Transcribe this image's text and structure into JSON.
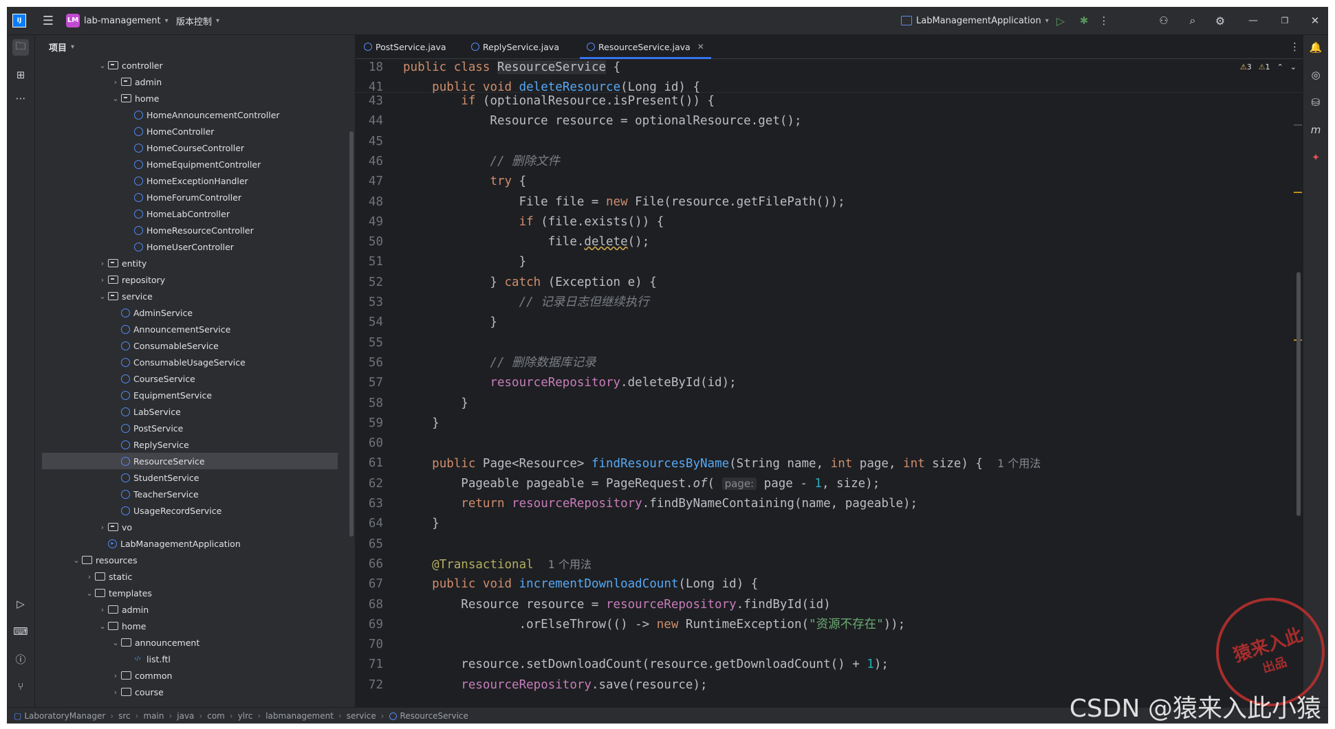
{
  "titlebar": {
    "project_badge": "LM",
    "project_name": "lab-management",
    "vcs_label": "版本控制",
    "run_config": "LabManagementApplication"
  },
  "project_panel": {
    "title": "项目",
    "tree": [
      {
        "label": "controller",
        "kind": "package",
        "arrow": "open",
        "indent": 0
      },
      {
        "label": "admin",
        "kind": "package",
        "arrow": "closed",
        "indent": 1
      },
      {
        "label": "home",
        "kind": "package",
        "arrow": "open",
        "indent": 1
      },
      {
        "label": "HomeAnnouncementController",
        "kind": "class",
        "indent": 2
      },
      {
        "label": "HomeController",
        "kind": "class",
        "indent": 2
      },
      {
        "label": "HomeCourseController",
        "kind": "class",
        "indent": 2
      },
      {
        "label": "HomeEquipmentController",
        "kind": "class",
        "indent": 2
      },
      {
        "label": "HomeExceptionHandler",
        "kind": "class",
        "indent": 2
      },
      {
        "label": "HomeForumController",
        "kind": "class",
        "indent": 2
      },
      {
        "label": "HomeLabController",
        "kind": "class",
        "indent": 2
      },
      {
        "label": "HomeResourceController",
        "kind": "class",
        "indent": 2
      },
      {
        "label": "HomeUserController",
        "kind": "class",
        "indent": 2
      },
      {
        "label": "entity",
        "kind": "package",
        "arrow": "closed",
        "indent": 0
      },
      {
        "label": "repository",
        "kind": "package",
        "arrow": "closed",
        "indent": 0
      },
      {
        "label": "service",
        "kind": "package",
        "arrow": "open",
        "indent": 0
      },
      {
        "label": "AdminService",
        "kind": "class",
        "indent": 1
      },
      {
        "label": "AnnouncementService",
        "kind": "class",
        "indent": 1
      },
      {
        "label": "ConsumableService",
        "kind": "class",
        "indent": 1
      },
      {
        "label": "ConsumableUsageService",
        "kind": "class",
        "indent": 1
      },
      {
        "label": "CourseService",
        "kind": "class",
        "indent": 1
      },
      {
        "label": "EquipmentService",
        "kind": "class",
        "indent": 1
      },
      {
        "label": "LabService",
        "kind": "class",
        "indent": 1
      },
      {
        "label": "PostService",
        "kind": "class",
        "indent": 1
      },
      {
        "label": "ReplyService",
        "kind": "class",
        "indent": 1
      },
      {
        "label": "ResourceService",
        "kind": "class",
        "indent": 1,
        "selected": true
      },
      {
        "label": "StudentService",
        "kind": "class",
        "indent": 1
      },
      {
        "label": "TeacherService",
        "kind": "class",
        "indent": 1
      },
      {
        "label": "UsageRecordService",
        "kind": "class",
        "indent": 1
      },
      {
        "label": "vo",
        "kind": "package",
        "arrow": "closed",
        "indent": 0
      },
      {
        "label": "LabManagementApplication",
        "kind": "app",
        "indent": 0
      },
      {
        "label": "resources",
        "kind": "folder",
        "arrow": "open",
        "indent": -2
      },
      {
        "label": "static",
        "kind": "folder",
        "arrow": "closed",
        "indent": -1
      },
      {
        "label": "templates",
        "kind": "folder",
        "arrow": "open",
        "indent": -1
      },
      {
        "label": "admin",
        "kind": "folder",
        "arrow": "closed",
        "indent": 0
      },
      {
        "label": "home",
        "kind": "folder",
        "arrow": "open",
        "indent": 0
      },
      {
        "label": "announcement",
        "kind": "folder",
        "arrow": "open",
        "indent": 1
      },
      {
        "label": "list.ftl",
        "kind": "ftl",
        "indent": 2
      },
      {
        "label": "common",
        "kind": "folder",
        "arrow": "closed",
        "indent": 1
      },
      {
        "label": "course",
        "kind": "folder",
        "arrow": "closed",
        "indent": 1
      }
    ]
  },
  "editor": {
    "tabs": [
      {
        "label": "PostService.java",
        "active": false
      },
      {
        "label": "ReplyService.java",
        "active": false
      },
      {
        "label": "ResourceService.java",
        "active": true
      }
    ],
    "inspections": {
      "warnings": "3",
      "weak_warnings": "1"
    },
    "sticky_lines": [
      {
        "n": "18",
        "html": "<span class=\"kw\">public class</span> <span class=\"hlcls\">ResourceService</span> {"
      },
      {
        "n": "41",
        "html": "    <span class=\"kw\">public void</span> <span class=\"fn\">deleteResource</span>(Long id) {"
      }
    ],
    "lines": [
      {
        "n": "43",
        "html": "        <span class=\"kw\">if</span> (optionalResource.isPresent()) {"
      },
      {
        "n": "44",
        "html": "            Resource resource = optionalResource.get();"
      },
      {
        "n": "45",
        "html": ""
      },
      {
        "n": "46",
        "html": "            <span class=\"cm\">// 删除文件</span>"
      },
      {
        "n": "47",
        "html": "            <span class=\"kw\">try</span> {"
      },
      {
        "n": "48",
        "html": "                File file = <span class=\"kw\">new</span> File(resource.getFilePath());"
      },
      {
        "n": "49",
        "html": "                <span class=\"kw\">if</span> (file.exists()) {"
      },
      {
        "n": "50",
        "html": "                    file.<span class=\"und\">delete</span>();"
      },
      {
        "n": "51",
        "html": "                }"
      },
      {
        "n": "52",
        "html": "            } <span class=\"kw\">catch</span> (Exception e) {"
      },
      {
        "n": "53",
        "html": "                <span class=\"cm\">// 记录日志但继续执行</span>"
      },
      {
        "n": "54",
        "html": "            }"
      },
      {
        "n": "55",
        "html": ""
      },
      {
        "n": "56",
        "html": "            <span class=\"cm\">// 删除数据库记录</span>"
      },
      {
        "n": "57",
        "html": "            <span class=\"fld\">resourceRepository</span>.deleteById(id);"
      },
      {
        "n": "58",
        "html": "        }"
      },
      {
        "n": "59",
        "html": "    }"
      },
      {
        "n": "60",
        "html": ""
      },
      {
        "n": "61",
        "html": "    <span class=\"kw\">public</span> Page&lt;Resource&gt; <span class=\"fn\">findResourcesByName</span>(String name, <span class=\"kw\">int</span> page, <span class=\"kw\">int</span> size) {  <span class=\"hint\">1 个用法</span>"
      },
      {
        "n": "62",
        "html": "        Pageable pageable = PageRequest.<i>of</i>( <span class=\"ph\">page:</span> page - <span class=\"num\">1</span>, size);"
      },
      {
        "n": "63",
        "html": "        <span class=\"kw\">return</span> <span class=\"fld\">resourceRepository</span>.findByNameContaining(name, pageable);"
      },
      {
        "n": "64",
        "html": "    }"
      },
      {
        "n": "65",
        "html": ""
      },
      {
        "n": "66",
        "html": "    <span class=\"ann\">@Transactional</span>  <span class=\"hint\">1 个用法</span>"
      },
      {
        "n": "67",
        "html": "    <span class=\"kw\">public void</span> <span class=\"fn\">incrementDownloadCount</span>(Long id) {"
      },
      {
        "n": "68",
        "html": "        Resource resource = <span class=\"fld\">resourceRepository</span>.findById(id)"
      },
      {
        "n": "69",
        "html": "                .orElseThrow(() -&gt; <span class=\"kw\">new</span> RuntimeException(<span class=\"str\">\"资源不存在\"</span>));"
      },
      {
        "n": "70",
        "html": ""
      },
      {
        "n": "71",
        "html": "        resource.setDownloadCount(resource.getDownloadCount() + <span class=\"num\">1</span>);"
      },
      {
        "n": "72",
        "html": "        <span class=\"fld\">resourceRepository</span>.save(resource);"
      }
    ]
  },
  "breadcrumbs": [
    "LaboratoryManager",
    "src",
    "main",
    "java",
    "com",
    "ylrc",
    "labmanagement",
    "service",
    "ResourceService"
  ],
  "watermark": {
    "text": "CSDN @猿来入此小猿",
    "stamp_line1": "猿来入此",
    "stamp_line2": "出品"
  }
}
